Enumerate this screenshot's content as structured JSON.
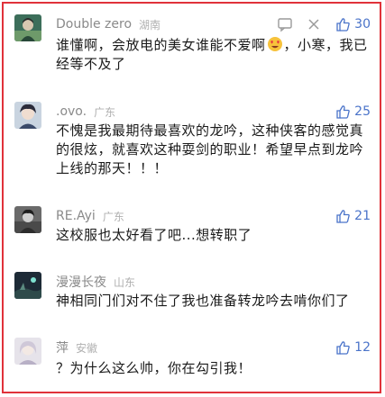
{
  "comments": [
    {
      "username": "Double zero",
      "location": "湖南",
      "text_before_emoji": "谁懂啊，会放电的美女谁能不爱啊",
      "text_after_emoji": "，小寒，我已经等不及了",
      "emoji": "heart-eyes-emoji",
      "likes": "30"
    },
    {
      "username": ".ovo.",
      "location": "广东",
      "text": "不愧是我最期待最喜欢的龙吟，这种侠客的感觉真的很炫，就喜欢这种耍剑的职业！希望早点到龙吟上线的那天！！！",
      "likes": "25"
    },
    {
      "username": "RE.Ayi",
      "location": "广东",
      "text": "这校服也太好看了吧...想转职了",
      "likes": "21"
    },
    {
      "username": "漫漫长夜",
      "location": "山东",
      "text": "神相同门们对不住了我也准备转龙吟去啃你们了",
      "likes": ""
    },
    {
      "username": "萍",
      "location": "安徽",
      "text": "？为什么这么帅，你在勾引我！",
      "likes": "12"
    }
  ],
  "colors": {
    "border": "#e0323a",
    "like": "#4a73c9",
    "username": "#8a8a8a",
    "location": "#b0b0b0",
    "text": "#1a1a1a"
  },
  "icons": {
    "reply": "reply-icon",
    "more": "more-icon",
    "like": "thumbs-up-icon"
  }
}
